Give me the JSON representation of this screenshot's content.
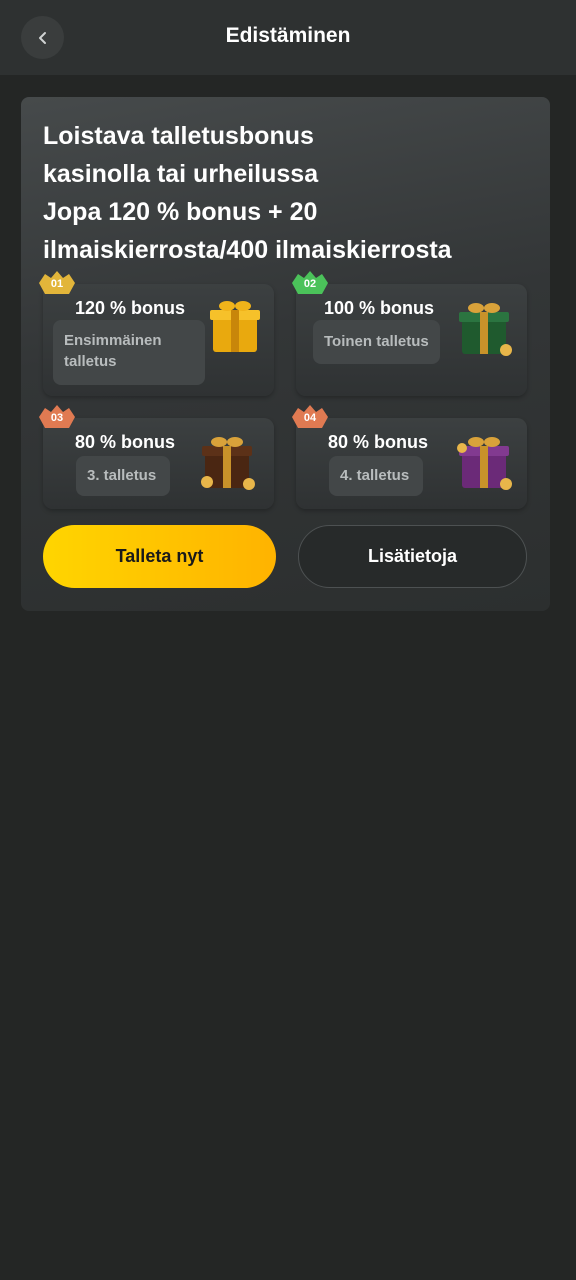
{
  "header": {
    "title": "Edistäminen",
    "back_icon": "chevron-left-icon"
  },
  "promo": {
    "headline_lines": [
      "Loistava talletusbonus",
      "kasinolla tai urheilussa",
      "Jopa 120 % bonus + 20",
      "ilmaiskierrosta/400 ilmaiskierrosta"
    ],
    "tiles": [
      {
        "badge": "01",
        "badge_color": "#e2b53a",
        "amount": "120 % bonus",
        "sub_line1": "Ensimmäinen",
        "sub_line2": "talletus",
        "gift_icon": "gold-gift-icon",
        "gift_color": "#e9a90e"
      },
      {
        "badge": "02",
        "badge_color": "#4bc25a",
        "amount": "100 % bonus",
        "sub_line1": "Toinen talletus",
        "gift_icon": "green-gift-icon",
        "gift_color": "#1f5a2e"
      },
      {
        "badge": "03",
        "badge_color": "#e07a52",
        "amount": "80 % bonus",
        "sub_line1": "3. talletus",
        "gift_icon": "brown-gift-icon",
        "gift_color": "#4a2612"
      },
      {
        "badge": "04",
        "badge_color": "#e07a52",
        "amount": "80 % bonus",
        "sub_line1": "4. talletus",
        "gift_icon": "purple-gift-icon",
        "gift_color": "#6b2a78"
      }
    ],
    "primary_button": "Talleta nyt",
    "secondary_button": "Lisätietoja"
  },
  "colors": {
    "background": "#242625",
    "accent": "#ffc800"
  }
}
